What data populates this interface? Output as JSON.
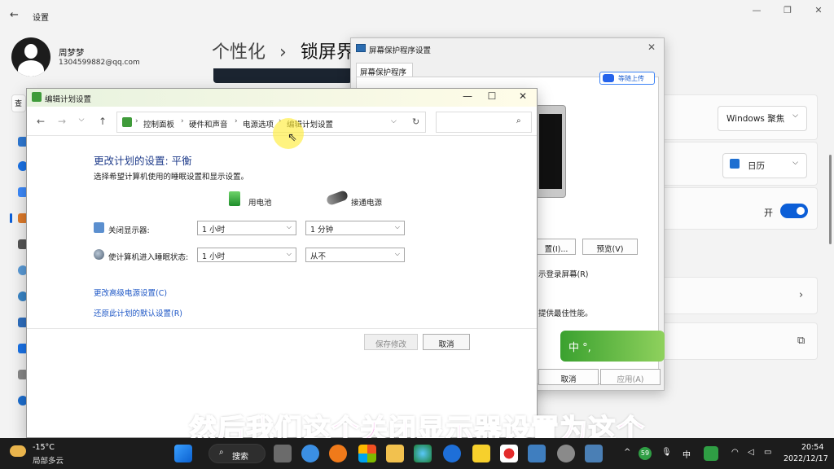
{
  "settings": {
    "title": "设置",
    "user_name": "周梦梦",
    "user_email": "1304599882@qq.com",
    "breadcrumb_parent": "个性化",
    "breadcrumb_sep": "›",
    "breadcrumb_current": "锁屏界",
    "lock_bg_value": "Windows 聚焦",
    "lock_status_app": "日历",
    "toggle_label": "开"
  },
  "screensaver": {
    "title": "屏幕保护程序设置",
    "tab": "屏幕保护程序",
    "cloud_label": "等随上传",
    "settings_btn": "置(I)...",
    "preview_btn": "预览(V)",
    "resume_text": "示登录屏幕(R)",
    "perf_text": "提供最佳性能。",
    "cancel_btn": "取消",
    "apply_btn": "应用(A)"
  },
  "ime": {
    "text": "中 °,"
  },
  "edit_plan": {
    "title": "编辑计划设置",
    "address": [
      "控制面板",
      "硬件和声音",
      "电源选项",
      "编辑计划设置"
    ],
    "heading": "更改计划的设置: 平衡",
    "subheading": "选择希望计算机使用的睡眠设置和显示设置。",
    "col_battery": "用电池",
    "col_plugged": "接通电源",
    "display_off_label": "关闭显示器:",
    "display_off_battery": "1 小时",
    "display_off_plugged": "1 分钟",
    "sleep_label": "使计算机进入睡眠状态:",
    "sleep_battery": "1 小时",
    "sleep_plugged": "从不",
    "link_advanced": "更改高级电源设置(C)",
    "link_restore": "还原此计划的默认设置(R)",
    "save_btn": "保存修改",
    "cancel_btn": "取消"
  },
  "subtitle": "然后我们这个关闭显示器设置为这个",
  "taskbar": {
    "temp": "-15°C",
    "weather": "局部多云",
    "search": "搜索",
    "ime_lang": "中",
    "badge": "59",
    "time": "20:54",
    "date": "2022/12/17"
  }
}
